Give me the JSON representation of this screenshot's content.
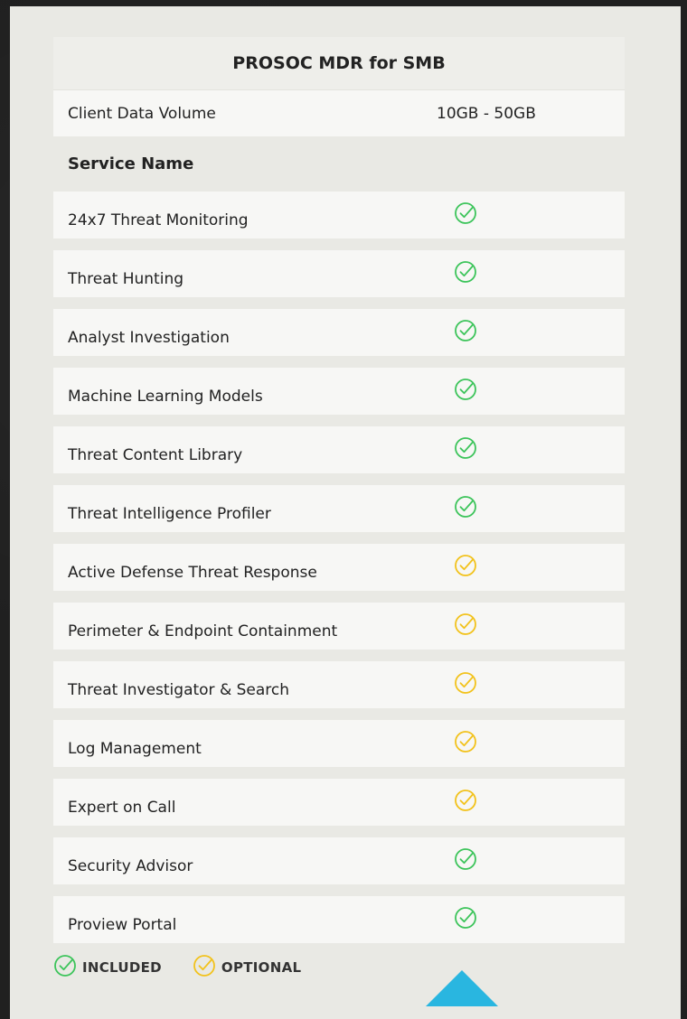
{
  "table": {
    "title": "PROSOC MDR for SMB",
    "volume_label": "Client Data Volume",
    "volume_value": "10GB - 50GB",
    "section_head": "Service Name",
    "rows": [
      {
        "name": "24x7 Threat Monitoring",
        "status": "included"
      },
      {
        "name": "Threat Hunting",
        "status": "included"
      },
      {
        "name": "Analyst Investigation",
        "status": "included"
      },
      {
        "name": "Machine Learning Models",
        "status": "included"
      },
      {
        "name": "Threat Content Library",
        "status": "included"
      },
      {
        "name": "Threat Intelligence Profiler",
        "status": "included"
      },
      {
        "name": "Active Defense Threat Response",
        "status": "optional"
      },
      {
        "name": "Perimeter & Endpoint Containment",
        "status": "optional"
      },
      {
        "name": "Threat Investigator & Search",
        "status": "optional"
      },
      {
        "name": "Log Management",
        "status": "optional"
      },
      {
        "name": "Expert on Call",
        "status": "optional"
      },
      {
        "name": "Security Advisor",
        "status": "included"
      },
      {
        "name": "Proview Portal",
        "status": "included"
      }
    ]
  },
  "legend": {
    "included_label": "INCLUDED",
    "optional_label": "OPTIONAL"
  },
  "icons": {
    "included": "check-circle-icon",
    "optional": "check-circle-icon"
  },
  "colors": {
    "included": "#3cc45a",
    "optional": "#f2c21b",
    "accent": "#29b6e0"
  }
}
